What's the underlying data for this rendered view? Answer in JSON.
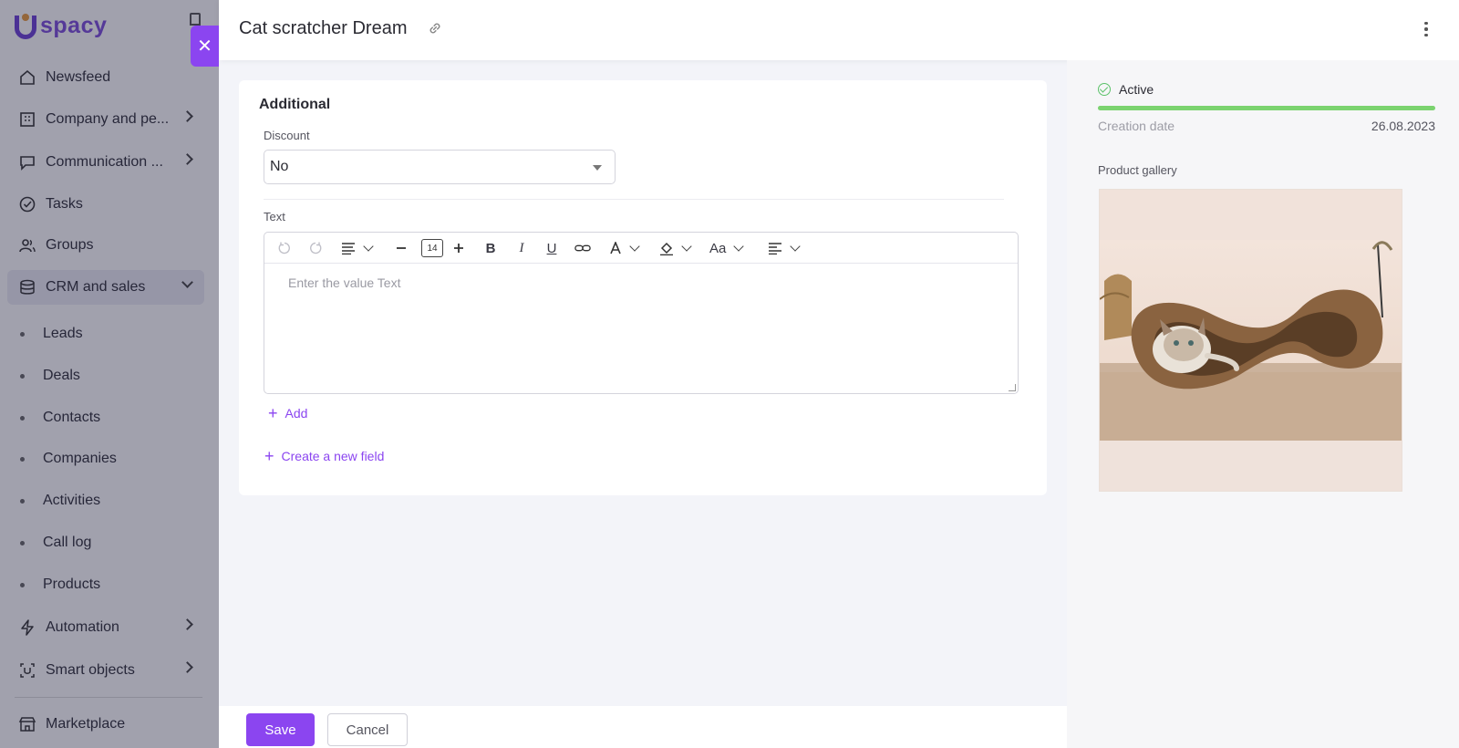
{
  "brand": {
    "logo_text": "spacy",
    "accent_color": "#8b45f0"
  },
  "sidebar": {
    "items": [
      {
        "label": "Newsfeed",
        "icon": "home-icon"
      },
      {
        "label": "Company and pe...",
        "icon": "building-icon"
      },
      {
        "label": "Communication ...",
        "icon": "chat-icon"
      },
      {
        "label": "Tasks",
        "icon": "check-circle-icon"
      },
      {
        "label": "Groups",
        "icon": "users-icon"
      },
      {
        "label": "CRM and sales",
        "icon": "database-icon"
      },
      {
        "label": "Automation",
        "icon": "lightning-icon"
      },
      {
        "label": "Smart objects",
        "icon": "smart-object-icon"
      },
      {
        "label": "Marketplace",
        "icon": "store-icon"
      }
    ],
    "crm_subitems": [
      "Leads",
      "Deals",
      "Contacts",
      "Companies",
      "Activities",
      "Call log",
      "Products"
    ]
  },
  "panel": {
    "title": "Cat scratcher Dream",
    "section_title": "Additional",
    "discount": {
      "label": "Discount",
      "value": "No"
    },
    "text_field": {
      "label": "Text",
      "placeholder": "Enter the value Text",
      "font_size": "14",
      "toolbar_case_label": "Aa"
    },
    "add_label": "Add",
    "create_field_label": "Create a new field",
    "status": {
      "label": "Active",
      "color": "#7bd36f",
      "progress": 1.0
    },
    "creation_date": {
      "label": "Creation date",
      "value": "26.08.2023"
    },
    "gallery_label": "Product gallery",
    "save_label": "Save",
    "cancel_label": "Cancel"
  }
}
